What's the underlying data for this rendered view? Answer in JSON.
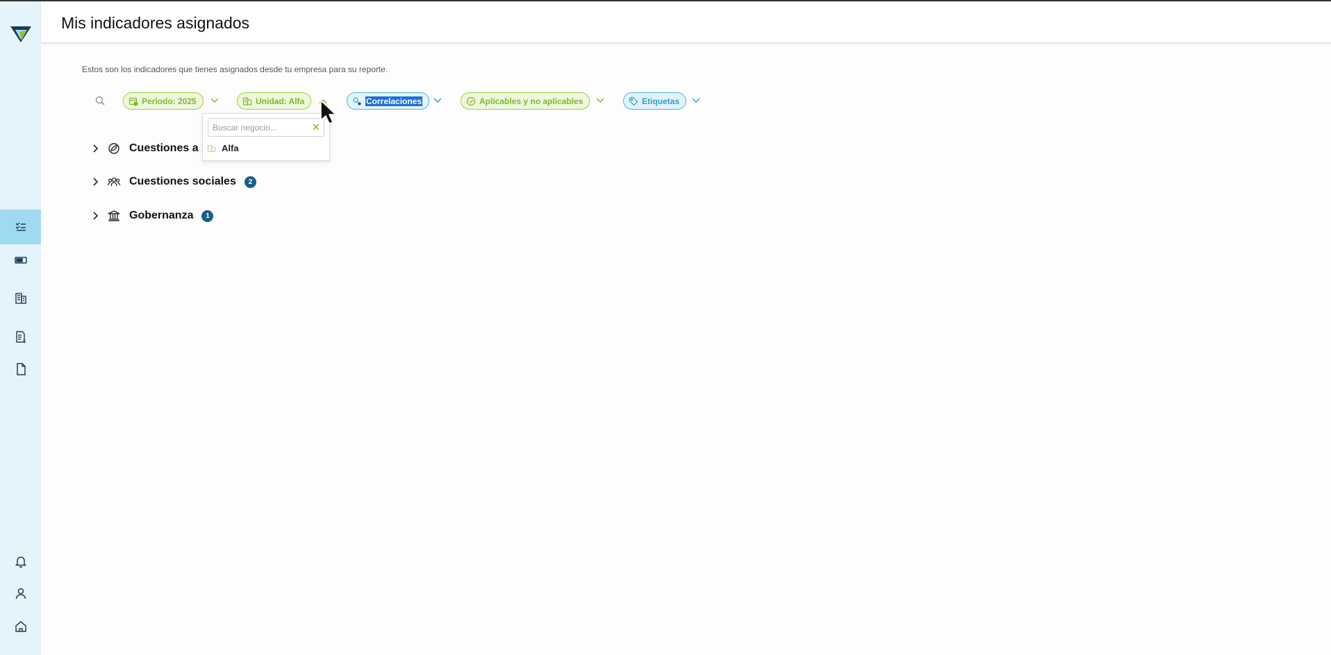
{
  "header": {
    "title": "Mis indicadores asignados"
  },
  "subtitle": "Estos son los indicadores que tienes asignados desde tu empresa para su reporte.",
  "filters": {
    "period": "Periodo: 2025",
    "unit": "Unidad: Alfa",
    "correlations": "Correlaciones",
    "applicable": "Aplicables y no aplicables",
    "tags": "Etiquetas"
  },
  "dropdown": {
    "placeholder": "Buscar negocio...",
    "option": "Alfa"
  },
  "groups": [
    {
      "label": "Cuestiones a",
      "badge": ""
    },
    {
      "label": "Cuestiones sociales",
      "badge": "2"
    },
    {
      "label": "Gobernanza",
      "badge": "1"
    }
  ],
  "colors": {
    "sidebar_bg": "#e5f4fa",
    "sidebar_active": "#9fdaf0",
    "green": "#7cb82d",
    "blue": "#2aa0cc",
    "badge": "#1a5d8a"
  }
}
